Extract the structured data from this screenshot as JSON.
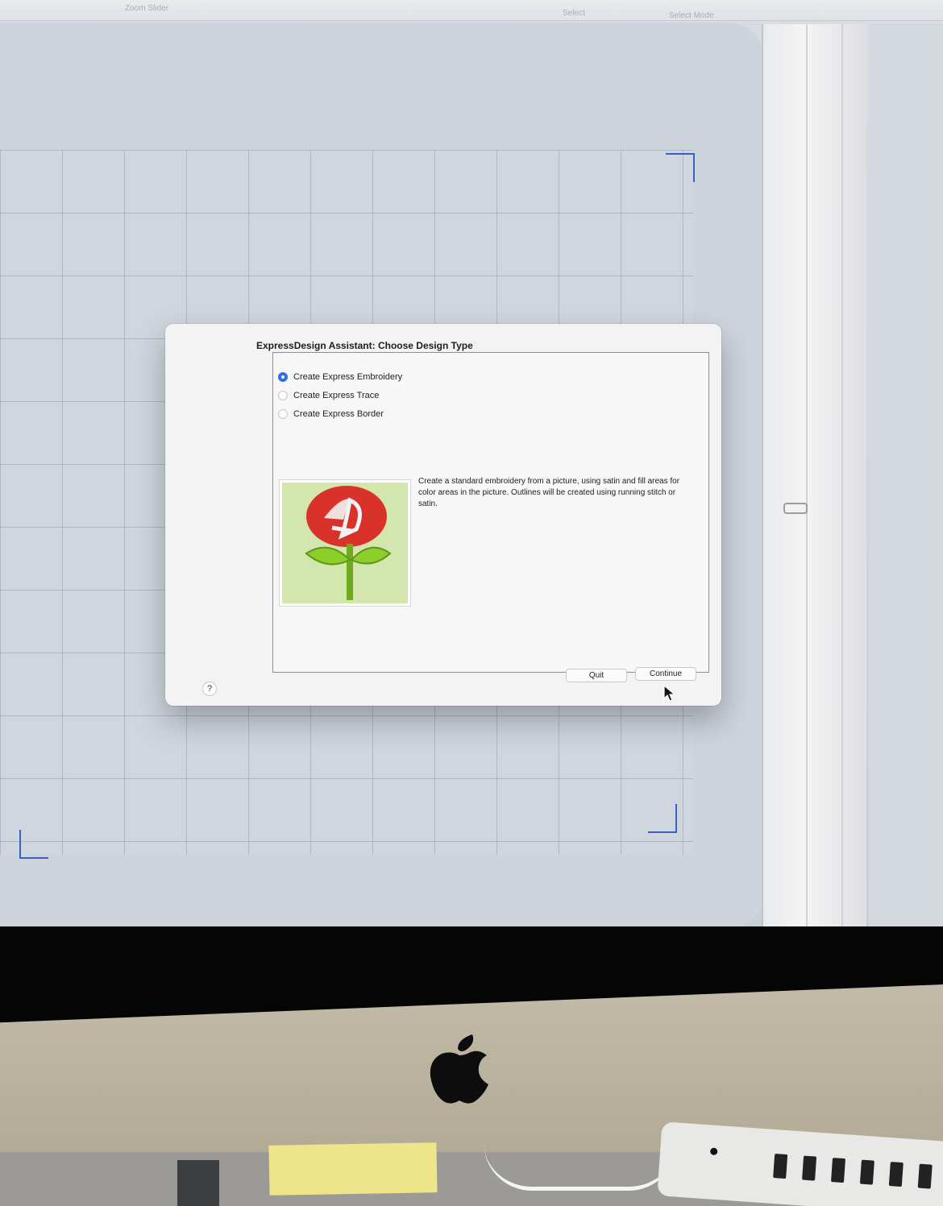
{
  "toolbar": {
    "zoom_label": "Zoom Slider",
    "select_label": "Select",
    "select_mode_label": "Select Mode"
  },
  "dialog": {
    "title": "ExpressDesign Assistant: Choose Design Type",
    "options": [
      {
        "label": "Create Express Embroidery",
        "selected": true
      },
      {
        "label": "Create Express Trace",
        "selected": false
      },
      {
        "label": "Create Express Border",
        "selected": false
      }
    ],
    "description": "Create a standard embroidery from a picture, using satin and fill areas for color areas in the picture. Outlines will be created using running stitch or satin.",
    "buttons": {
      "quit": "Quit",
      "continue": "Continue",
      "help": "?"
    }
  },
  "colors": {
    "accent": "#2c6fe8",
    "hoop_corner": "#3a5fc8",
    "rose_red": "#d8322b",
    "leaf_green": "#8ccf2a",
    "preview_bg": "#d3e6ad"
  },
  "icons": [
    "help-icon",
    "rose-embroidery-preview",
    "mouse-cursor-icon",
    "apple-logo-icon"
  ]
}
